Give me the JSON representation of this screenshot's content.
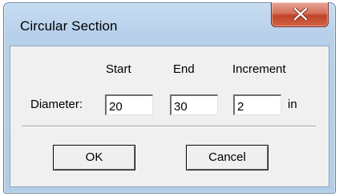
{
  "window": {
    "title": "Circular Section"
  },
  "form": {
    "headers": {
      "start": "Start",
      "end": "End",
      "increment": "Increment"
    },
    "diameter": {
      "label": "Diameter:",
      "start": "20",
      "end": "30",
      "increment": "2",
      "unit": "in"
    }
  },
  "buttons": {
    "ok": "OK",
    "cancel": "Cancel"
  },
  "icons": {
    "close": "close-icon"
  },
  "colors": {
    "title_bar": "#b7d0ea",
    "close_button": "#c1432a",
    "client_background": "#f0f0f0"
  }
}
